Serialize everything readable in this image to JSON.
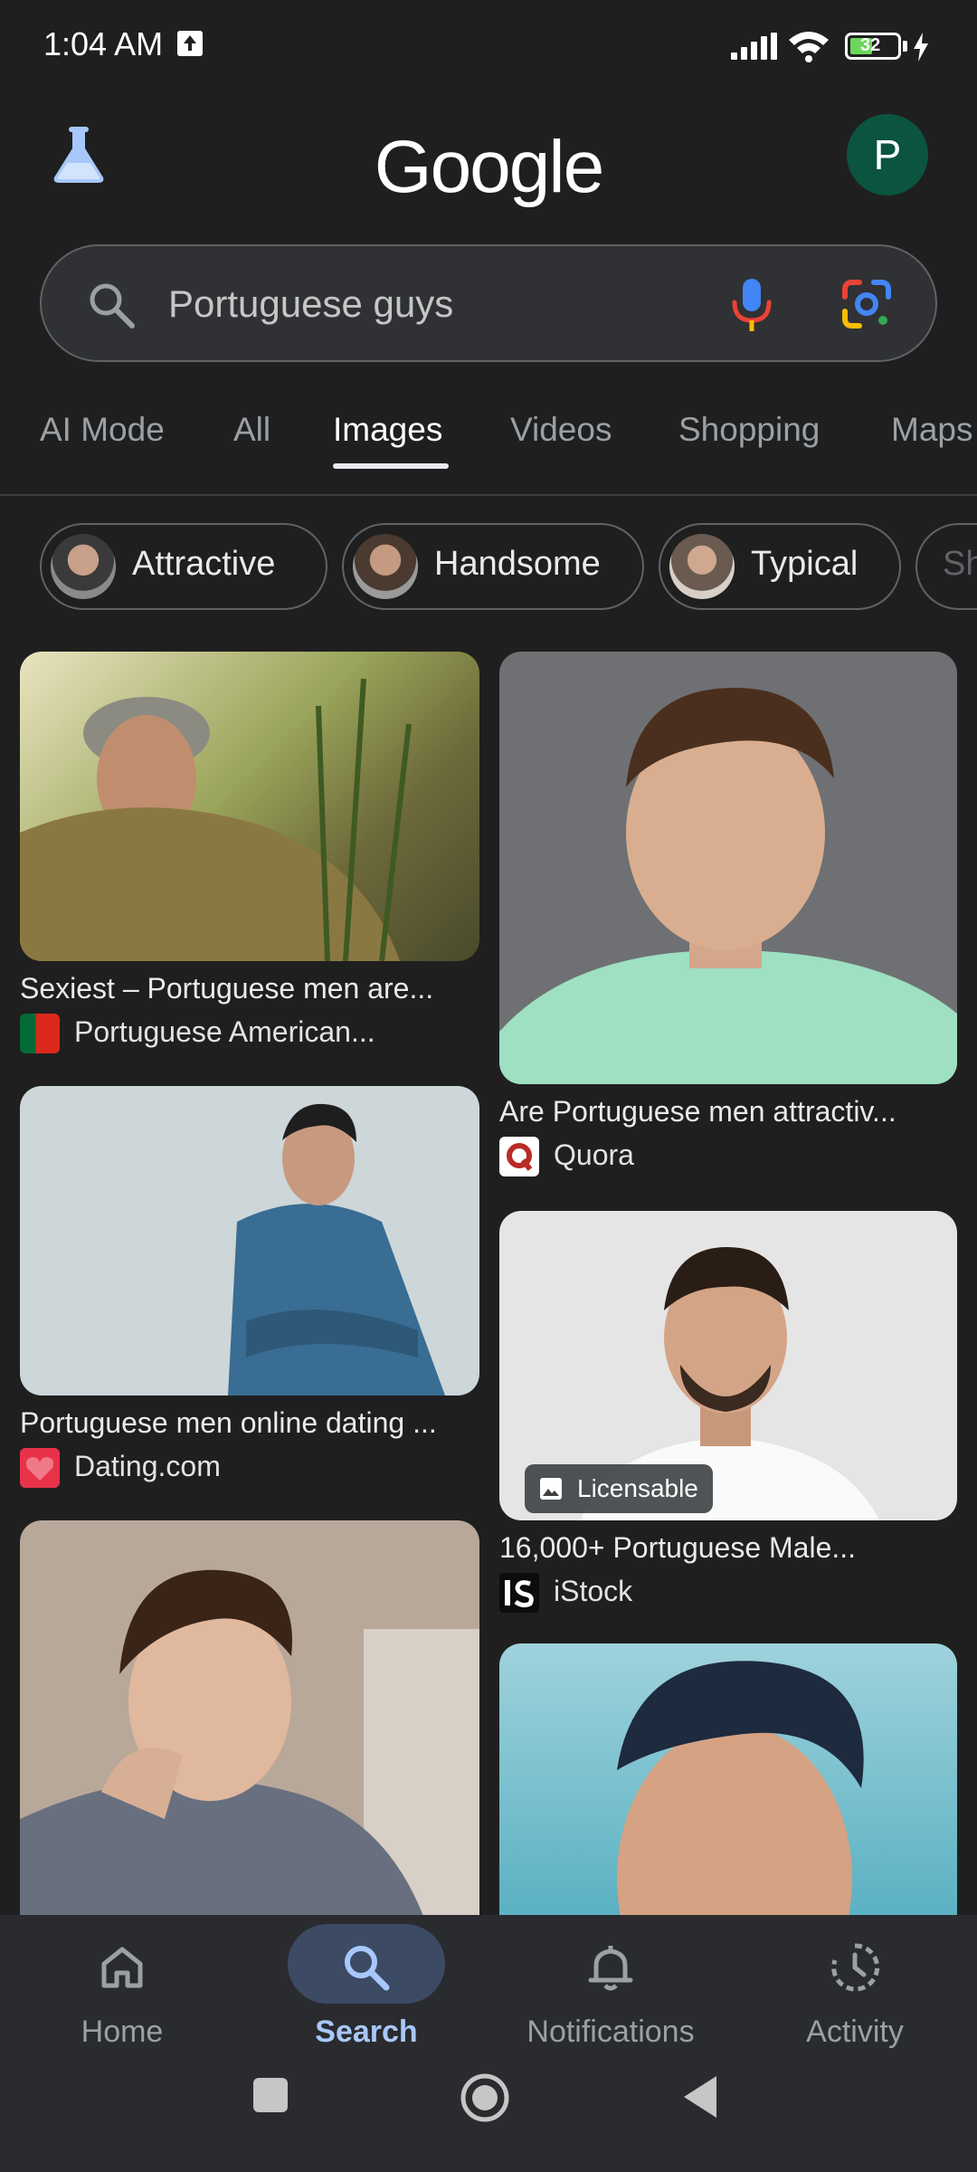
{
  "status_bar": {
    "time": "1:04 AM",
    "battery": "32"
  },
  "header": {
    "logo_text": "Google",
    "avatar_letter": "P"
  },
  "search": {
    "query": "Portuguese guys"
  },
  "tabs": [
    {
      "label": "AI Mode"
    },
    {
      "label": "All"
    },
    {
      "label": "Images"
    },
    {
      "label": "Videos"
    },
    {
      "label": "Shopping"
    },
    {
      "label": "Maps"
    }
  ],
  "active_tab": "Images",
  "chips": [
    {
      "label": "Attractive"
    },
    {
      "label": "Handsome"
    },
    {
      "label": "Typical"
    },
    {
      "label": "Sh"
    }
  ],
  "results": [
    {
      "title": "Sexiest – Portuguese men are...",
      "source": "Portuguese American..."
    },
    {
      "title": "Are Portuguese men attractiv...",
      "source": "Quora"
    },
    {
      "title": "Portuguese men online dating ...",
      "source": "Dating.com"
    },
    {
      "title": "16,000+ Portuguese Male...",
      "source": "iStock",
      "badge": "Licensable"
    }
  ],
  "bottom_nav": [
    {
      "label": "Home"
    },
    {
      "label": "Search"
    },
    {
      "label": "Notifications"
    },
    {
      "label": "Activity"
    }
  ],
  "colors": {
    "background": "#1f1f1f",
    "accent": "#a8c7fa",
    "avatar_bg": "#0b5440"
  }
}
